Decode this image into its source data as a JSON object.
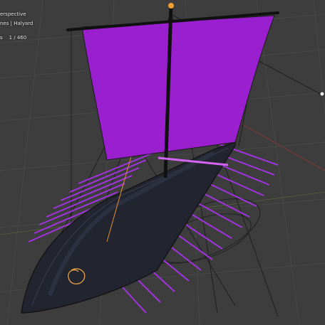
{
  "overlay": {
    "view_name": "erspective",
    "collection": "nes | Halyard",
    "frame_prefix": "s",
    "frame_value": "1 / 460"
  },
  "colors": {
    "background": "#3d3d3d",
    "grid": "#4a4a4a",
    "hull": "#232531",
    "sail": "#9a1fcf",
    "oar": "#a533e6",
    "rope_dark": "#1a1a1a",
    "rope_orange": "#e0902a",
    "selection": "#f0a030",
    "x_axis": "#8a3b3b",
    "y_axis": "#6b8a3b"
  },
  "icons": [
    "navigation-gizmo-icon"
  ]
}
